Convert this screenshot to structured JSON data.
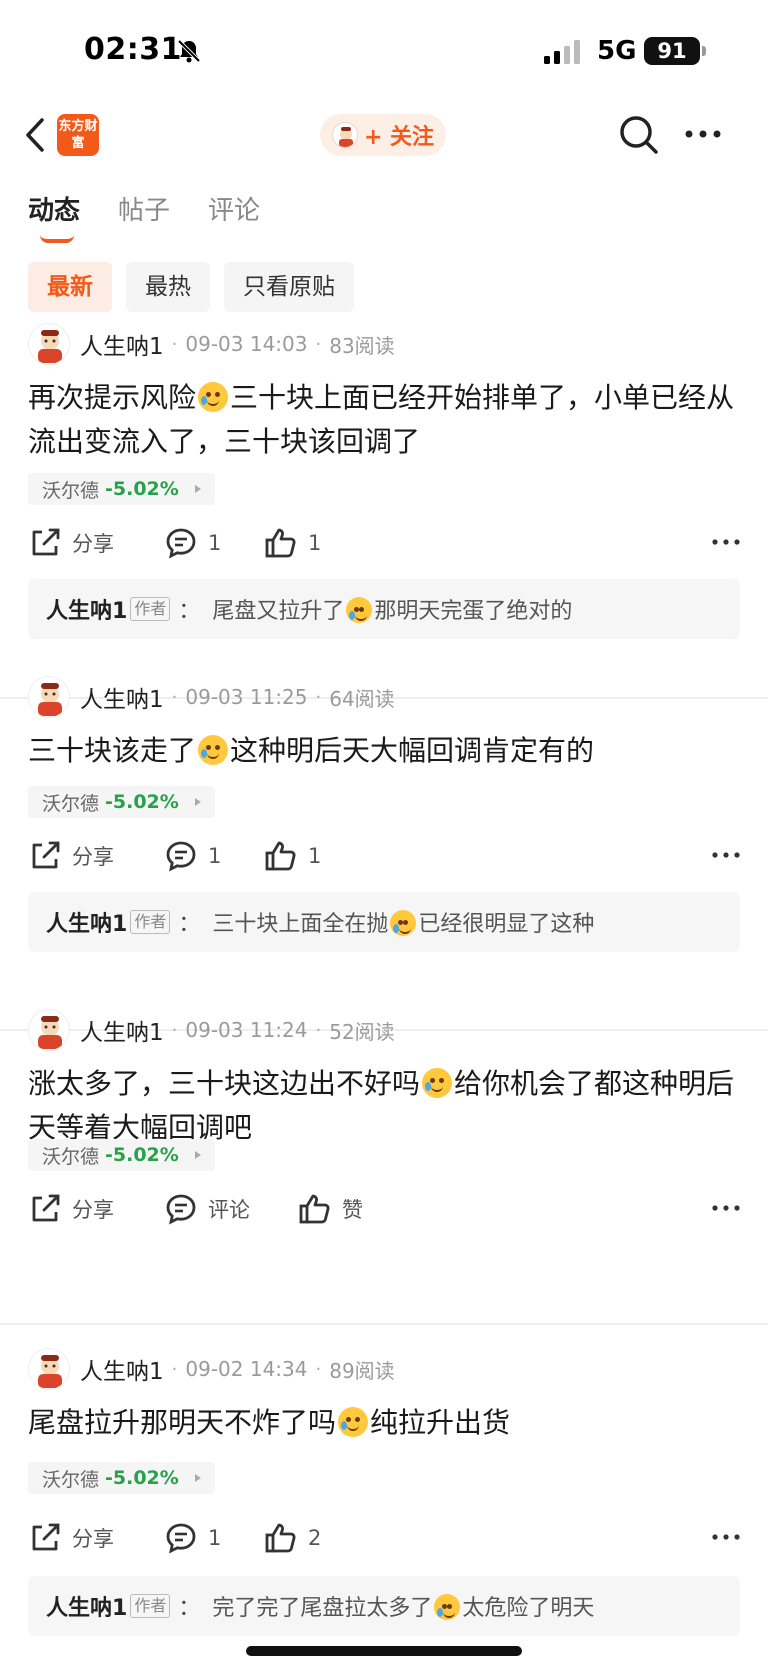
{
  "status_bar": {
    "time": "02:31",
    "network": "5G",
    "battery": "91"
  },
  "nav": {
    "logo_text": "东方财富",
    "follow_label": "+ 关注"
  },
  "tabs": [
    {
      "label": "动态",
      "active": true
    },
    {
      "label": "帖子",
      "active": false
    },
    {
      "label": "评论",
      "active": false
    }
  ],
  "filters": [
    {
      "label": "最新",
      "active": true
    },
    {
      "label": "最热",
      "active": false
    },
    {
      "label": "只看原贴",
      "active": false
    }
  ],
  "posts": [
    {
      "author": "人生呐1",
      "time": "09-03 14:03",
      "reads": "83阅读",
      "content_a": "再次提示风险",
      "content_b": "三十块上面已经开始排单了，小单已经从流出变流入了，三十块该回调了",
      "stock": {
        "name": "沃尔德",
        "change": "-5.02%"
      },
      "share": "分享",
      "comments": "1",
      "likes": "1",
      "reply": {
        "author": "人生呐1",
        "badge": "作者",
        "colon": "：",
        "text_a": "尾盘又拉升了",
        "text_b": "那明天完蛋了绝对的"
      }
    },
    {
      "author": "人生呐1",
      "time": "09-03 11:25",
      "reads": "64阅读",
      "content_a": "三十块该走了",
      "content_b": "这种明后天大幅回调肯定有的",
      "stock": {
        "name": "沃尔德",
        "change": "-5.02%"
      },
      "share": "分享",
      "comments": "1",
      "likes": "1",
      "reply": {
        "author": "人生呐1",
        "badge": "作者",
        "colon": "：",
        "text_a": "三十块上面全在抛",
        "text_b": "已经很明显了这种"
      }
    },
    {
      "author": "人生呐1",
      "time": "09-03 11:24",
      "reads": "52阅读",
      "content_a": "涨太多了，三十块这边出不好吗",
      "content_b": "给你机会了都这种明后天等着大幅回调吧",
      "stock": {
        "name": "沃尔德",
        "change": "-5.02%"
      },
      "share": "分享",
      "comments": "评论",
      "likes": "赞"
    },
    {
      "author": "人生呐1",
      "time": "09-02 14:34",
      "reads": "89阅读",
      "content_a": "尾盘拉升那明天不炸了吗",
      "content_b": "纯拉升出货",
      "stock": {
        "name": "沃尔德",
        "change": "-5.02%"
      },
      "share": "分享",
      "comments": "1",
      "likes": "2",
      "reply": {
        "author": "人生呐1",
        "badge": "作者",
        "colon": "：",
        "text_a": "完了完了尾盘拉太多了",
        "text_b": "太危险了明天"
      }
    }
  ],
  "colors": {
    "accent": "#f05a1a",
    "down": "#27a24b"
  }
}
